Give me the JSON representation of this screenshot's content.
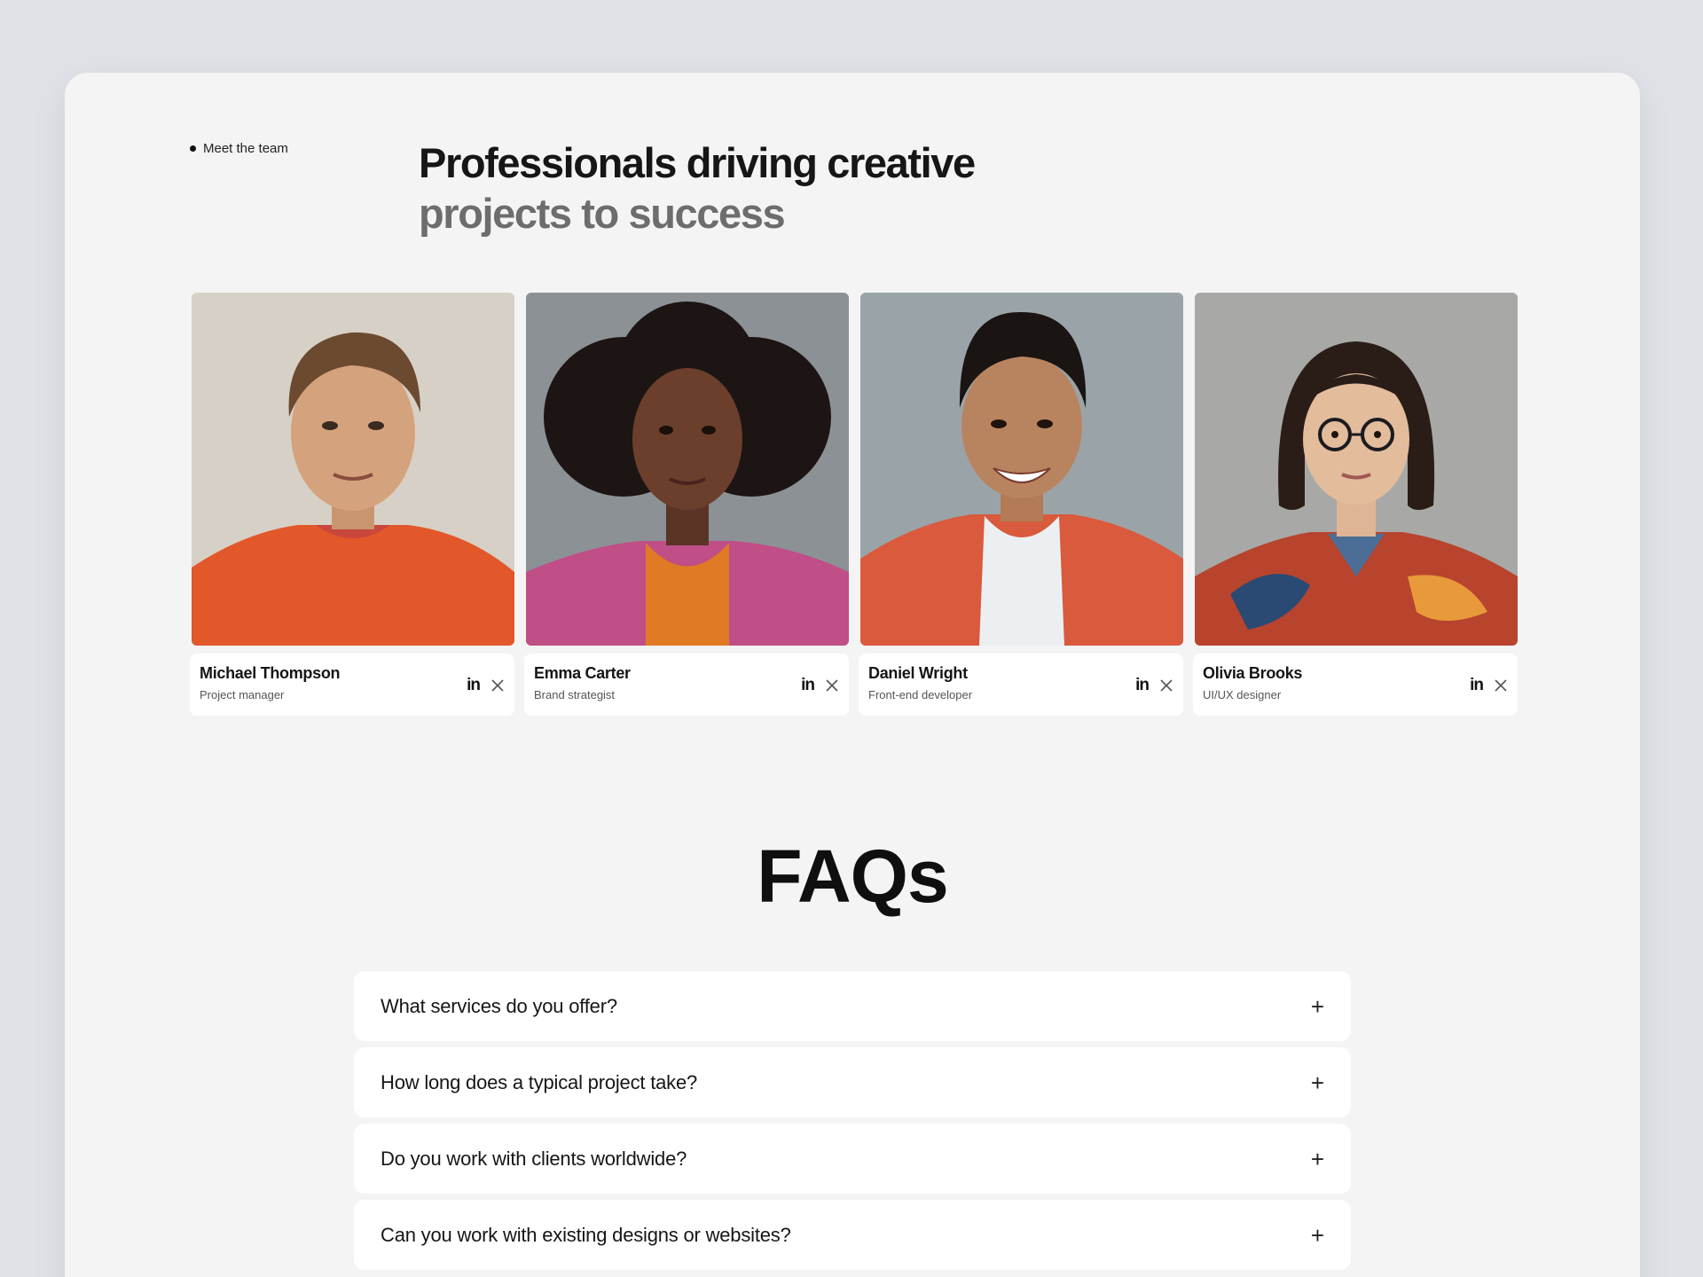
{
  "team_section": {
    "eyebrow": "Meet the team",
    "headline_line1": "Professionals driving creative",
    "headline_line2": "projects to success",
    "members": [
      {
        "name": "Michael Thompson",
        "role": "Project manager",
        "social": [
          "linkedin-icon",
          "x-icon"
        ]
      },
      {
        "name": "Emma Carter",
        "role": "Brand strategist",
        "social": [
          "linkedin-icon",
          "x-icon"
        ]
      },
      {
        "name": "Daniel Wright",
        "role": "Front-end developer",
        "social": [
          "linkedin-icon",
          "x-icon"
        ]
      },
      {
        "name": "Olivia Brooks",
        "role": "UI/UX designer",
        "social": [
          "linkedin-icon",
          "x-icon"
        ]
      }
    ],
    "linkedin_glyph": "in"
  },
  "faq_section": {
    "title": "FAQs",
    "items": [
      {
        "question": "What services do you offer?",
        "toggle": "+"
      },
      {
        "question": "How long does a typical project take?",
        "toggle": "+"
      },
      {
        "question": "Do you work with clients worldwide?",
        "toggle": "+"
      },
      {
        "question": "Can you work with existing designs or websites?",
        "toggle": "+"
      }
    ]
  },
  "colors": {
    "background": "#dfe2e6",
    "card": "#f4f4f4",
    "surface": "#ffffff",
    "headline_muted": "#6d6d6d"
  }
}
